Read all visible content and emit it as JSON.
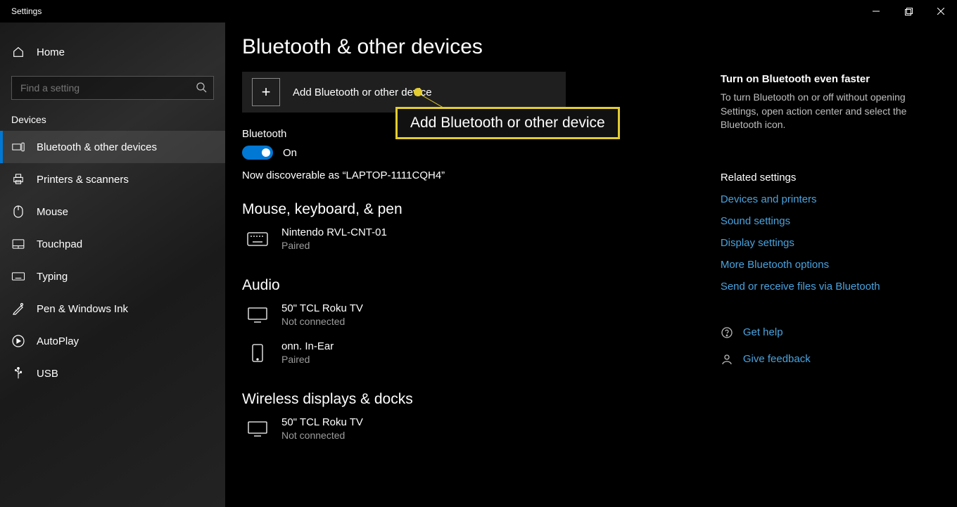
{
  "window": {
    "title": "Settings"
  },
  "sidebar": {
    "home": "Home",
    "search_placeholder": "Find a setting",
    "section": "Devices",
    "items": [
      {
        "label": "Bluetooth & other devices",
        "active": true
      },
      {
        "label": "Printers & scanners"
      },
      {
        "label": "Mouse"
      },
      {
        "label": "Touchpad"
      },
      {
        "label": "Typing"
      },
      {
        "label": "Pen & Windows Ink"
      },
      {
        "label": "AutoPlay"
      },
      {
        "label": "USB"
      }
    ]
  },
  "main": {
    "title": "Bluetooth & other devices",
    "add_label": "Add Bluetooth or other device",
    "bluetooth_label": "Bluetooth",
    "toggle_state": "On",
    "discoverable": "Now discoverable as “LAPTOP-1111CQH4”",
    "groups": {
      "mouse": {
        "title": "Mouse, keyboard, & pen",
        "devices": [
          {
            "name": "Nintendo RVL-CNT-01",
            "status": "Paired"
          }
        ]
      },
      "audio": {
        "title": "Audio",
        "devices": [
          {
            "name": "50\" TCL Roku TV",
            "status": "Not connected"
          },
          {
            "name": "onn. In-Ear",
            "status": "Paired"
          }
        ]
      },
      "wireless": {
        "title": "Wireless displays & docks",
        "devices": [
          {
            "name": "50\" TCL Roku TV",
            "status": "Not connected"
          }
        ]
      }
    }
  },
  "right": {
    "tip_title": "Turn on Bluetooth even faster",
    "tip_body": "To turn Bluetooth on or off without opening Settings, open action center and select the Bluetooth icon.",
    "related_title": "Related settings",
    "links": [
      "Devices and printers",
      "Sound settings",
      "Display settings",
      "More Bluetooth options",
      "Send or receive files via Bluetooth"
    ],
    "help": "Get help",
    "feedback": "Give feedback"
  },
  "callout": "Add Bluetooth or other device"
}
